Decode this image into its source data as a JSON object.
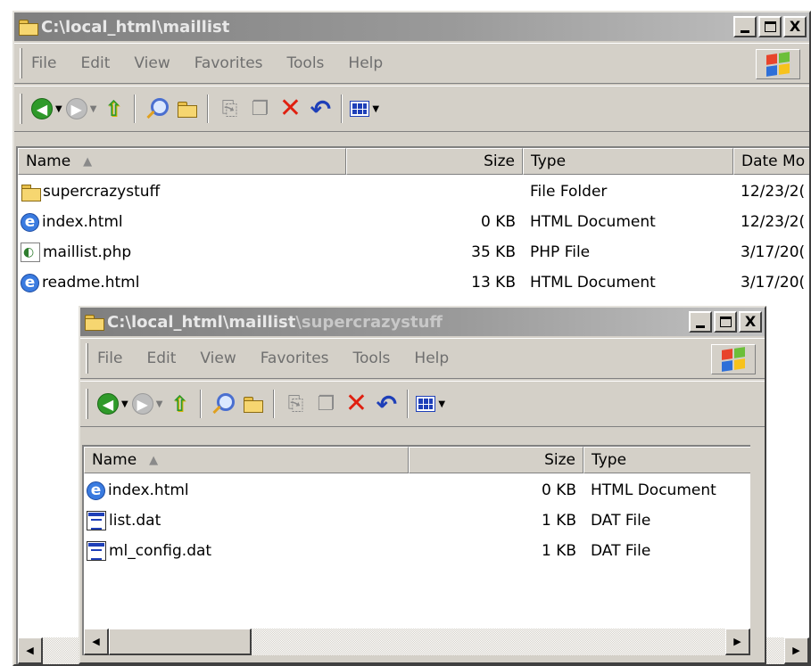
{
  "back_window": {
    "title": "C:\\local_html\\maillist",
    "menu": [
      "File",
      "Edit",
      "View",
      "Favorites",
      "Tools",
      "Help"
    ],
    "menu_access_keys": [
      "F",
      "E",
      "V",
      "a",
      "T",
      "H"
    ],
    "columns": [
      "Name",
      "Size",
      "Type",
      "Date Mo"
    ],
    "files": [
      {
        "icon": "folder-icon",
        "name": "supercrazystuff",
        "size": "",
        "type": "File Folder",
        "date": "12/23/2("
      },
      {
        "icon": "ie-document-icon",
        "name": "index.html",
        "size": "0 KB",
        "type": "HTML Document",
        "date": "12/23/2("
      },
      {
        "icon": "php-file-icon",
        "name": "maillist.php",
        "size": "35 KB",
        "type": "PHP File",
        "date": "3/17/20("
      },
      {
        "icon": "ie-document-icon",
        "name": "readme.html",
        "size": "13 KB",
        "type": "HTML Document",
        "date": "3/17/20("
      }
    ]
  },
  "front_window": {
    "title_path": "C:\\local_html\\maillist",
    "title_tail": "\\supercrazystuff",
    "menu": [
      "File",
      "Edit",
      "View",
      "Favorites",
      "Tools",
      "Help"
    ],
    "columns": [
      "Name",
      "Size",
      "Type"
    ],
    "files": [
      {
        "icon": "ie-document-icon",
        "name": "index.html",
        "size": "0 KB",
        "type": "HTML Document"
      },
      {
        "icon": "dat-file-icon",
        "name": "list.dat",
        "size": "1 KB",
        "type": "DAT File"
      },
      {
        "icon": "dat-file-icon",
        "name": "ml_config.dat",
        "size": "1 KB",
        "type": "DAT File"
      }
    ]
  },
  "caption_buttons": {
    "minimize": "_",
    "maximize": "□",
    "close": "X"
  },
  "toolbar_icons": [
    "back-icon",
    "forward-icon",
    "up-folder-icon",
    "search-icon",
    "folders-icon",
    "move-to-icon",
    "copy-to-icon",
    "delete-icon",
    "undo-icon",
    "views-icon"
  ],
  "glyphs": {
    "back": "◀",
    "forward": "▶",
    "dropdown": "▼",
    "sort_asc": "▲",
    "scroll_left": "◀",
    "scroll_right": "▶",
    "ie": "e"
  },
  "colors": {
    "inactive_title_start": "#7f7f7f",
    "inactive_title_end": "#c2c2c2",
    "face": "#d4d0c8"
  }
}
